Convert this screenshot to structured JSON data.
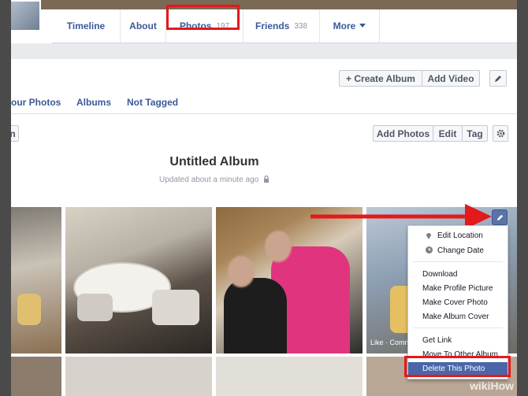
{
  "nav": {
    "tabs": [
      {
        "label": "Timeline",
        "count": ""
      },
      {
        "label": "About",
        "count": ""
      },
      {
        "label": "Photos",
        "count": "197"
      },
      {
        "label": "Friends",
        "count": "338"
      },
      {
        "label": "More",
        "count": ""
      }
    ]
  },
  "toolbar": {
    "create_album": "+ Create Album",
    "add_video": "Add Video"
  },
  "subnav": {
    "your_photos": "our Photos",
    "albums": "Albums",
    "not_tagged": "Not Tagged"
  },
  "album_actions": {
    "back_partial": "n",
    "add_photos": "Add Photos",
    "edit": "Edit",
    "tag": "Tag"
  },
  "album": {
    "title": "Untitled Album",
    "updated": "Updated about a minute ago"
  },
  "photo_overlay": {
    "like_comment": "Like · Comm"
  },
  "menu": {
    "items": [
      {
        "label": "Edit Location",
        "icon": "location-pin-icon"
      },
      {
        "label": "Change Date",
        "icon": "clock-icon"
      },
      {
        "label": "Download"
      },
      {
        "label": "Make Profile Picture"
      },
      {
        "label": "Make Cover Photo"
      },
      {
        "label": "Make Album Cover"
      },
      {
        "label": "Get Link"
      },
      {
        "label": "Move To Other Album"
      },
      {
        "label": "Delete This Photo"
      }
    ]
  },
  "watermark": "wikiHow",
  "colors": {
    "accent": "#3b5998",
    "highlight": "#e3191b",
    "selected": "#4a66a8"
  }
}
